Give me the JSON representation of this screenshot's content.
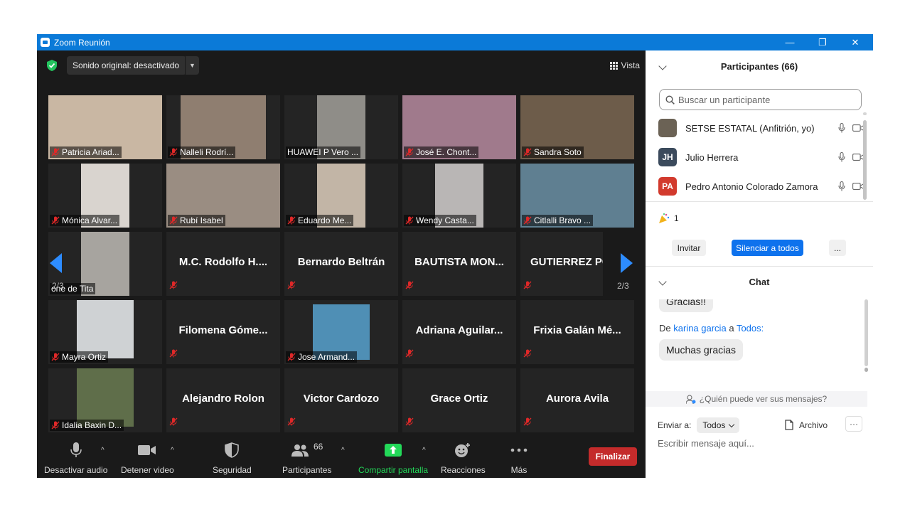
{
  "window": {
    "title": "Zoom Reunión",
    "controls": {
      "minimize": "—",
      "restore": "❐",
      "close": "✕"
    }
  },
  "topbar": {
    "sound_button": "Sonido original: desactivado",
    "view_button": "Vista"
  },
  "grid": {
    "page_left": "2/3",
    "page_right": "2/3",
    "tiles": [
      {
        "name": "Patricia Ariad...",
        "video": true,
        "color": "#c9b7a3"
      },
      {
        "name": "Nalleli Rodrí...",
        "video": true,
        "color": "#8f7e70"
      },
      {
        "name": "HUAWEI P Vero ...",
        "video": true,
        "color": "#8f8d88"
      },
      {
        "name": "José E. Chont...",
        "video": true,
        "color": "#a07a8c"
      },
      {
        "name": "Sandra Soto",
        "video": true,
        "color": "#6d5c4a"
      },
      {
        "name": "Mónica Alvar...",
        "video": true,
        "color": "#d9d4cf"
      },
      {
        "name": "Rubí Isabel",
        "video": true,
        "color": "#9a8d82"
      },
      {
        "name": "Eduardo Me...",
        "video": true,
        "color": "#c2b5a6"
      },
      {
        "name": "Wendy Casta...",
        "video": true,
        "color": "#b9b6b5"
      },
      {
        "name": "Citlalli Bravo ...",
        "video": true,
        "color": "#5f7f91"
      },
      {
        "name": "one de Tita",
        "video": true,
        "color": "#a7a49f"
      },
      {
        "name": "M.C. Rodolfo H....",
        "video": false
      },
      {
        "name": "Bernardo Beltrán",
        "video": false
      },
      {
        "name": "BAUTISTA MON...",
        "video": false
      },
      {
        "name": "GUTIERREZ PC",
        "video": false
      },
      {
        "name": "Mayra Ortiz",
        "video": true,
        "color": "#cfd2d4"
      },
      {
        "name": "Filomena Góme...",
        "video": false
      },
      {
        "name": "Jose Armand...",
        "video": true,
        "color": "#4f8fb5"
      },
      {
        "name": "Adriana Aguilar...",
        "video": false
      },
      {
        "name": "Frixia Galán Mé...",
        "video": false
      },
      {
        "name": "Idalia Baxin D...",
        "video": true,
        "color": "#5f6e4a"
      },
      {
        "name": "Alejandro Rolon",
        "video": false
      },
      {
        "name": "Victor Cardozo",
        "video": false
      },
      {
        "name": "Grace Ortiz",
        "video": false
      },
      {
        "name": "Aurora Avila",
        "video": false
      }
    ]
  },
  "toolbar": {
    "mute_audio": "Desactivar audio",
    "stop_video": "Detener video",
    "security": "Seguridad",
    "participants": "Participantes",
    "participants_count": "66",
    "share_screen": "Compartir pantalla",
    "reactions": "Reacciones",
    "more": "Más",
    "end": "Finalizar"
  },
  "participants_panel": {
    "title": "Participantes (66)",
    "search_placeholder": "Buscar un participante",
    "rows": [
      {
        "name": "SETSE ESTATAL (Anfitrión, yo)",
        "initials": "",
        "color": "#6b6255"
      },
      {
        "name": "Julio Herrera",
        "initials": "JH",
        "color": "#3b4a5c"
      },
      {
        "name": "Pedro Antonio Colorado Zamora",
        "initials": "PA",
        "color": "#d23a2d"
      }
    ],
    "reaction_count": "1",
    "invite": "Invitar",
    "mute_all": "Silenciar a todos",
    "more": "..."
  },
  "chat_panel": {
    "title": "Chat",
    "partial_message": "Gracias!!",
    "from_prefix": "De",
    "from_name": "karina garcia",
    "to_word": "a",
    "to_name": "Todos",
    "to_suffix": ":",
    "message": "Muchas gracias",
    "who_sees": "¿Quién puede ver sus mensajes?",
    "send_to_label": "Enviar a:",
    "send_to_value": "Todos",
    "file_label": "Archivo",
    "more": "···",
    "input_placeholder": "Escribir mensaje aquí..."
  },
  "colors": {
    "titlebar": "#0b7ad8",
    "end_button": "#c42b2b",
    "accent_blue": "#0e72ed",
    "share_green": "#23d959"
  }
}
